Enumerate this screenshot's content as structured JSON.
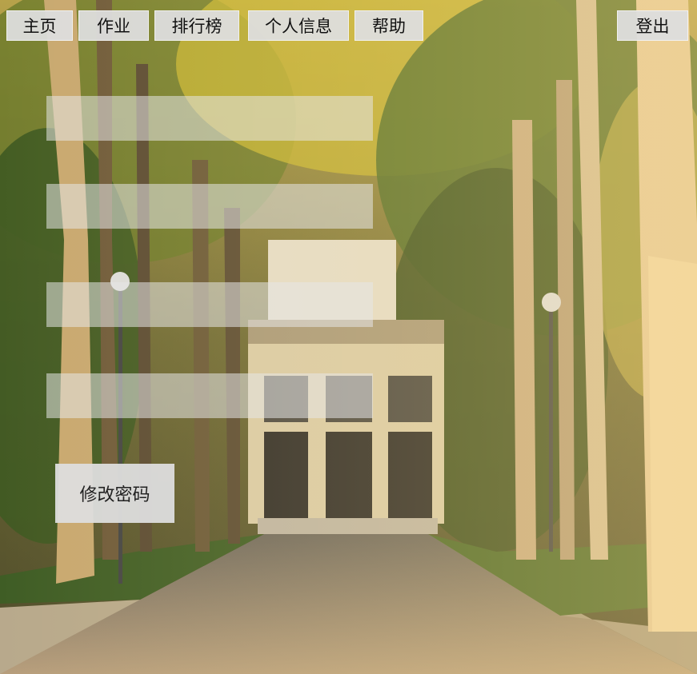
{
  "nav": {
    "home": "主页",
    "homework": "作业",
    "ranking": "排行榜",
    "profile": "个人信息",
    "help": "帮助",
    "logout": "登出"
  },
  "form": {
    "field1_value": "",
    "field2_value": "",
    "field3_value": "",
    "field4_value": "",
    "submit_label": "修改密码"
  }
}
